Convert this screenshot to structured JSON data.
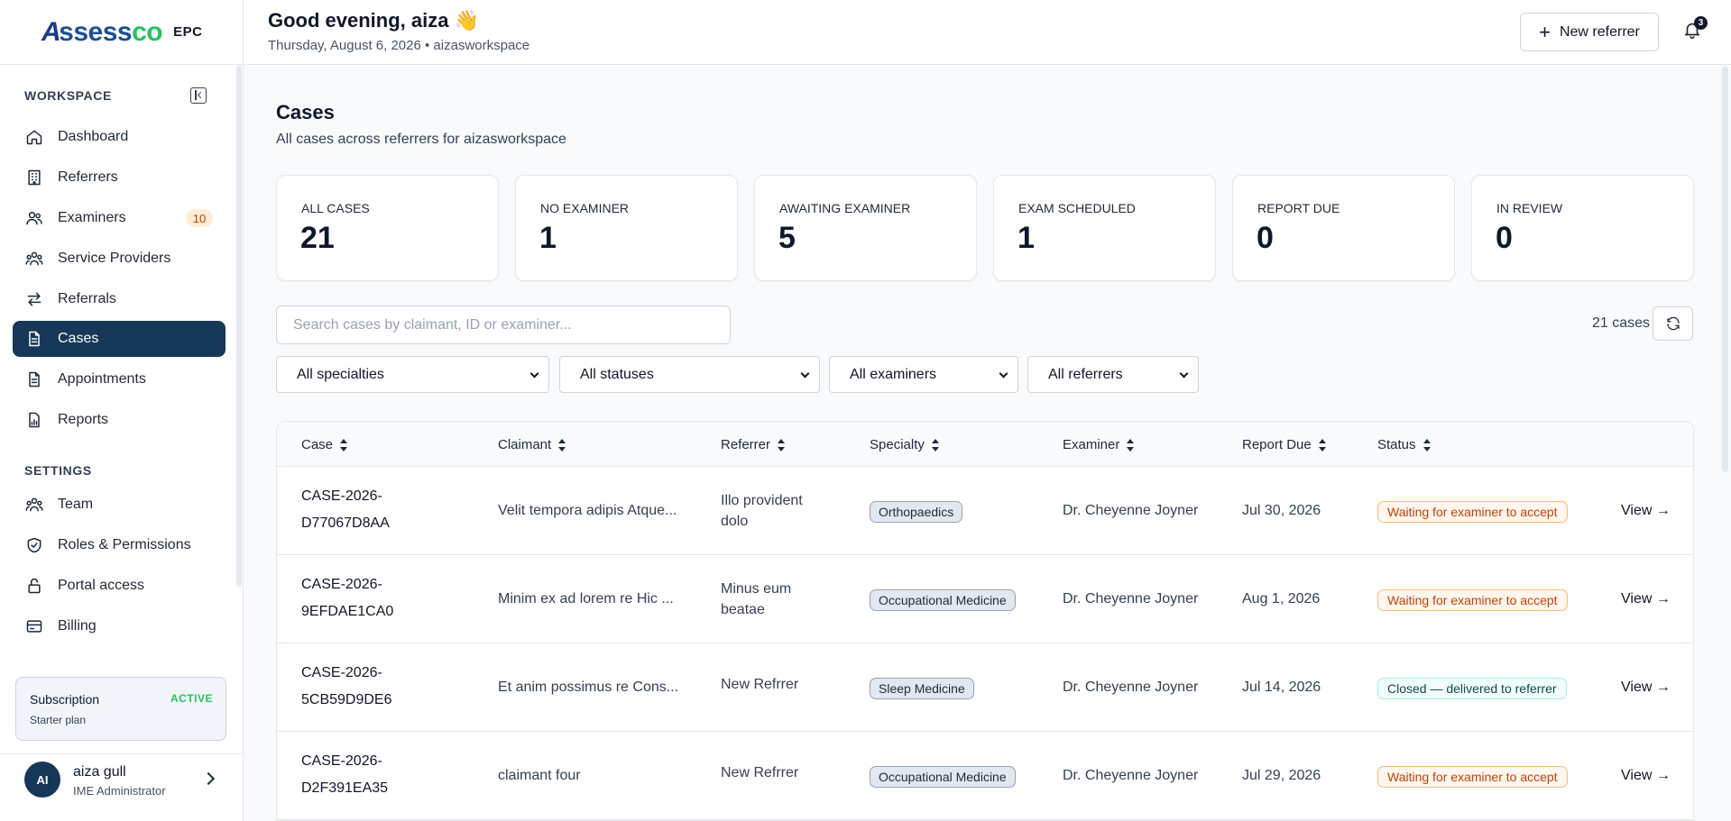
{
  "brand": {
    "logo_a": "A",
    "logo_ssess": "ssess",
    "logo_co": "co",
    "suffix": "EPC"
  },
  "sidebar": {
    "workspace_label": "WORKSPACE",
    "settings_label": "SETTINGS",
    "workspace_items": [
      {
        "label": "Dashboard",
        "icon": "home-icon"
      },
      {
        "label": "Referrers",
        "icon": "building-icon"
      },
      {
        "label": "Examiners",
        "icon": "users-icon",
        "badge": "10"
      },
      {
        "label": "Service Providers",
        "icon": "group-icon"
      },
      {
        "label": "Referrals",
        "icon": "arrows-icon"
      },
      {
        "label": "Cases",
        "icon": "file-icon",
        "active": true
      },
      {
        "label": "Appointments",
        "icon": "document-icon"
      },
      {
        "label": "Reports",
        "icon": "chart-icon"
      }
    ],
    "settings_items": [
      {
        "label": "Team",
        "icon": "group-icon"
      },
      {
        "label": "Roles & Permissions",
        "icon": "shield-icon"
      },
      {
        "label": "Portal access",
        "icon": "lock-icon"
      },
      {
        "label": "Billing",
        "icon": "credit-card-icon"
      }
    ],
    "subscription": {
      "title": "Subscription",
      "status": "ACTIVE",
      "plan": "Starter plan"
    },
    "user": {
      "initials": "AI",
      "name": "aiza gull",
      "role": "IME Administrator"
    }
  },
  "header": {
    "greeting": "Good evening, aiza 👋",
    "date_line": "Thursday, August 6, 2026 • aizasworkspace",
    "new_referrer_label": "New referrer",
    "notification_count": "3"
  },
  "page": {
    "title": "Cases",
    "subtitle": "All cases across referrers for aizasworkspace"
  },
  "stats": [
    {
      "label": "ALL CASES",
      "value": "21"
    },
    {
      "label": "NO EXAMINER",
      "value": "1"
    },
    {
      "label": "AWAITING EXAMINER",
      "value": "5"
    },
    {
      "label": "EXAM SCHEDULED",
      "value": "1"
    },
    {
      "label": "REPORT DUE",
      "value": "0"
    },
    {
      "label": "IN REVIEW",
      "value": "0"
    }
  ],
  "search": {
    "placeholder": "Search cases by claimant, ID or examiner..."
  },
  "case_count": "21 cases",
  "filters": {
    "specialty": "All specialties",
    "status": "All statuses",
    "examiner": "All examiners",
    "referrer": "All referrers"
  },
  "table": {
    "columns": [
      "Case",
      "Claimant",
      "Referrer",
      "Specialty",
      "Examiner",
      "Report Due",
      "Status"
    ],
    "view_label": "View →",
    "rows": [
      {
        "case_line1": "CASE-2026-",
        "case_line2": "D77067D8AA",
        "claimant": "Velit tempora adipis Atque...",
        "referrer": "Illo provident dolo",
        "specialty": "Orthopaedics",
        "examiner": "Dr. Cheyenne Joyner",
        "due": "Jul 30, 2026",
        "status": "Waiting for examiner to accept",
        "status_kind": "waiting"
      },
      {
        "case_line1": "CASE-2026-",
        "case_line2": "9EFDAE1CA0",
        "claimant": "Minim ex ad lorem re Hic ...",
        "referrer": "Minus eum beatae",
        "specialty": "Occupational Medicine",
        "examiner": "Dr. Cheyenne Joyner",
        "due": "Aug 1, 2026",
        "status": "Waiting for examiner to accept",
        "status_kind": "waiting"
      },
      {
        "case_line1": "CASE-2026-",
        "case_line2": "5CB59D9DE6",
        "claimant": "Et anim possimus re Cons...",
        "referrer": "New Refrrer",
        "specialty": "Sleep Medicine",
        "examiner": "Dr. Cheyenne Joyner",
        "due": "Jul 14, 2026",
        "status": "Closed — delivered to referrer",
        "status_kind": "closed"
      },
      {
        "case_line1": "CASE-2026-",
        "case_line2": "D2F391EA35",
        "claimant": "claimant four",
        "referrer": "New Refrrer",
        "specialty": "Occupational Medicine",
        "examiner": "Dr. Cheyenne Joyner",
        "due": "Jul 29, 2026",
        "status": "Waiting for examiner to accept",
        "status_kind": "waiting"
      }
    ]
  },
  "colors": {
    "primary": "#163757",
    "accent_green": "#22c55e",
    "badge_orange": "#c2410c"
  }
}
